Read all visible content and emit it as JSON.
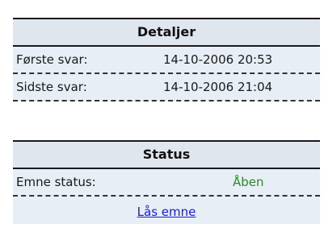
{
  "details": {
    "title": "Detaljer",
    "rows": [
      {
        "label": "Første svar:",
        "value": "14-10-2006 20:53"
      },
      {
        "label": "Sidste svar:",
        "value": "14-10-2006 21:04"
      }
    ]
  },
  "status": {
    "title": "Status",
    "topic_status_label": "Emne status:",
    "topic_status_value": "Åben",
    "lock_link": "Lås emne"
  },
  "colors": {
    "header_bg": "#dfe6ee",
    "body_bg": "#e7eef5",
    "status_green": "#2c8a2c",
    "link_blue": "#1a1ae6"
  }
}
